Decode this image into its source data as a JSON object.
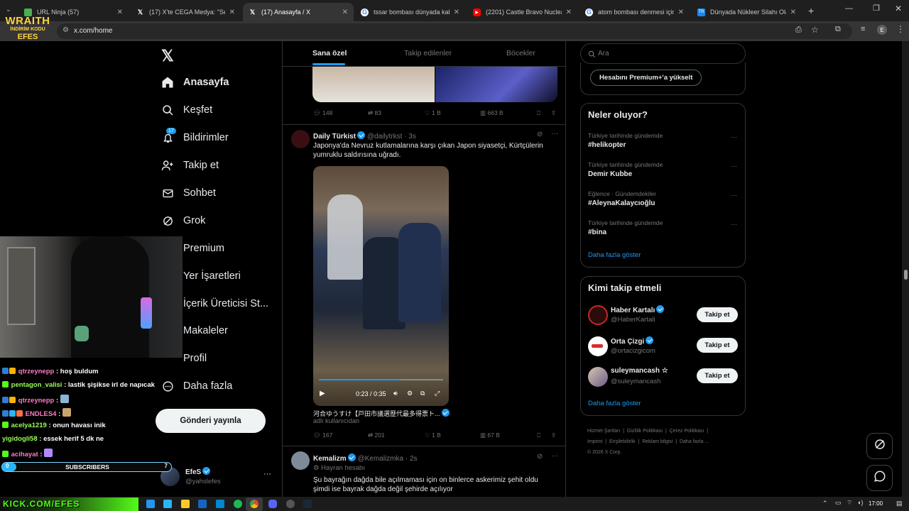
{
  "browser": {
    "tabs": [
      {
        "title": "URL Ninja (57)",
        "favicon": "#4caf50"
      },
      {
        "title": "(17) X'te CEGA Medya: \"Selahat",
        "favicon": "x"
      },
      {
        "title": "(17) Anasayfa / X",
        "favicon": "x"
      },
      {
        "title": "tssar bombası dünyada kaldı mı",
        "favicon": "google"
      },
      {
        "title": "(2201) Castle Bravo Nuclear Tes",
        "favicon": "youtube"
      },
      {
        "title": "atom bombası denmesi için kaç",
        "favicon": "google"
      },
      {
        "title": "Dünyada Nükleer Silahı Olan Ü",
        "favicon": "#1e88e5"
      }
    ],
    "url": "x.com/home",
    "profile_initial": "E"
  },
  "overlay": {
    "logo_line1": "WRAITH",
    "logo_line2": "İNDİRİM KODU",
    "logo_line3": "EFES",
    "chat": [
      {
        "user": "qtrzeynepp",
        "color": "#ff7ac6",
        "msg": ": hoş buldum"
      },
      {
        "user": "pentagon_valisi",
        "color": "#9cff57",
        "msg": ": lastik şişikse irl de napıcak"
      },
      {
        "user": "qtrzeynepp",
        "color": "#ff7ac6",
        "msg": ":"
      },
      {
        "user": "ENDLES4",
        "color": "#ff7ac6",
        "msg": ":"
      },
      {
        "user": "acelya1219",
        "color": "#9cff57",
        "msg": ": onun havası inik"
      },
      {
        "user": "yigidogli58",
        "color": "#9cff57",
        "msg": ": essek herif 5 dk ne"
      },
      {
        "user": "acihayat",
        "color": "#ff7ac6",
        "msg": ":"
      }
    ],
    "subs_label": "SUBSCRIBERS",
    "subs_left": "0",
    "subs_right": "7",
    "banner": "KICK.COM/EFES"
  },
  "nav": {
    "home": "Anasayfa",
    "explore": "Keşfet",
    "notifications": "Bildirimler",
    "notif_count": "17",
    "follow": "Takip et",
    "chat": "Sohbet",
    "grok": "Grok",
    "premium": "Premium",
    "bookmarks": "Yer İşaretleri",
    "creator": "İçerik Üreticisi St...",
    "articles": "Makaleler",
    "profile": "Profil",
    "more": "Daha fazla",
    "post_button": "Gönderi yayınla"
  },
  "account": {
    "name": "EfeS",
    "handle": "@yahslefes"
  },
  "feed": {
    "tabs": [
      "Sana özel",
      "Takip edilenler",
      "Böcekler"
    ],
    "post0": {
      "replies": "148",
      "reposts": "83",
      "likes": "1 B",
      "views": "663 B"
    },
    "post1": {
      "name": "Daily Türkist",
      "handle": "@dailytrkst",
      "time": "· 3s",
      "text": "Japonya'da Nevruz kutlamalarına karşı çıkan Japon siyasetçi, Kürtçülerin yumruklu saldırısına uğradı.",
      "video_time": "0:23 / 0:35",
      "caption": "河合ゆうすけ【戸田市議選歴代最多得票ト...",
      "caption_sub": "adlı kullanıcıdan",
      "replies": "167",
      "reposts": "201",
      "likes": "1 B",
      "views": "67 B"
    },
    "post2": {
      "name": "Kemalizm",
      "handle": "@Kemalizmka",
      "time": "· 2s",
      "context": "Hayran hesabı",
      "text": "Şu bayrağın dağda bile açılmaması için on binlerce askerimiz şehit oldu şimdi ise bayrak dağda değil şehirde açılıyor"
    }
  },
  "sidebar": {
    "search_placeholder": "Ara",
    "premium_button": "Hesabını Premium+'a yükselt",
    "trends_title": "Neler oluyor?",
    "trends": [
      {
        "category": "Türkiye tarihinde gündemde",
        "name": "#helikopter"
      },
      {
        "category": "Türkiye tarihinde gündemde",
        "name": "Demir Kubbe"
      },
      {
        "category": "Eğlence · Gündemdekiler",
        "name": "#AleynaKalaycıoğlu"
      },
      {
        "category": "Türkiye tarihinde gündemde",
        "name": "#bina"
      }
    ],
    "trends_more": "Daha fazla göster",
    "who_title": "Kimi takip etmeli",
    "who": [
      {
        "name": "Haber Kartalı",
        "handle": "@HaberKartali",
        "button": "Takip et"
      },
      {
        "name": "Orta Çizgi",
        "handle": "@ortacizgicom",
        "button": "Takip et"
      },
      {
        "name": "suleymancash ☆",
        "handle": "@suleymancash",
        "button": "Takip et"
      }
    ],
    "who_more": "Daha fazla göster",
    "footer1": [
      "Hizmet Şartları",
      "Gizlilik Politikası",
      "Çerez Politikası"
    ],
    "footer2": [
      "Imprint",
      "Erişilebilirlik",
      "Reklam bilgisi",
      "Daha fazla ..."
    ],
    "copyright": "© 2026 X Corp."
  },
  "taskbar": {
    "time": "17:00"
  }
}
